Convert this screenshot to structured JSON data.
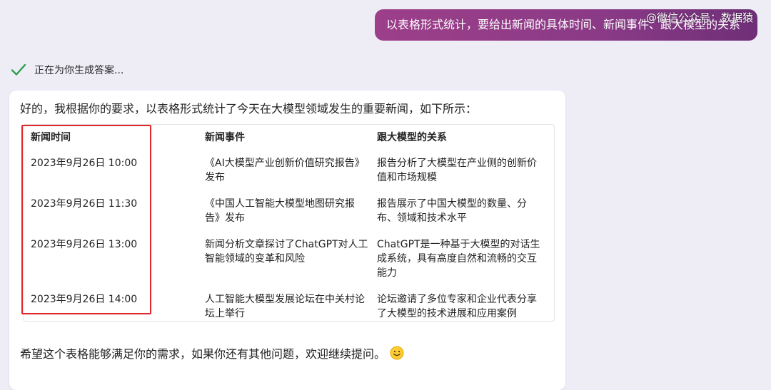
{
  "user_message": "以表格形式统计，要给出新闻的具体时间、新闻事件、跟大模型的关系",
  "watermark": "@微信公众号：数据猿",
  "status_text": "正在为你生成答案...",
  "response": {
    "intro": "好的，我根据你的要求，以表格形式统计了今天在大模型领域发生的重要新闻，如下所示：",
    "table": {
      "headers": [
        "新闻时间",
        "新闻事件",
        "跟大模型的关系"
      ],
      "rows": [
        {
          "time": "2023年9月26日 10:00",
          "event": [
            "《AI大模型产业创新价值研究报告》",
            "发布"
          ],
          "relation": [
            "报告分析了大模型在产业侧的创新价",
            "值和市场规模"
          ]
        },
        {
          "time": "2023年9月26日 11:30",
          "event": [
            "《中国人工智能大模型地图研究报",
            "告》发布"
          ],
          "relation": [
            "报告展示了中国大模型的数量、分",
            "布、领域和技术水平"
          ]
        },
        {
          "time": "2023年9月26日 13:00",
          "event": [
            "新闻分析文章探讨了ChatGPT对人工",
            "智能领域的变革和风险"
          ],
          "relation": [
            "ChatGPT是一种基于大模型的对话生",
            "成系统，具有高度自然和流畅的交互",
            "能力"
          ]
        },
        {
          "time": "2023年9月26日 14:00",
          "event": [
            "人工智能大模型发展论坛在中关村论",
            "坛上举行"
          ],
          "relation": [
            "论坛邀请了多位专家和企业代表分享",
            "了大模型的技术进展和应用案例"
          ]
        }
      ]
    },
    "outro": "希望这个表格能够满足你的需求，如果你还有其他问题，欢迎继续提问。"
  },
  "colors": {
    "user_bubble": "#8a3a86",
    "highlight_box": "#e0282a",
    "check": "#2e9e4f"
  }
}
